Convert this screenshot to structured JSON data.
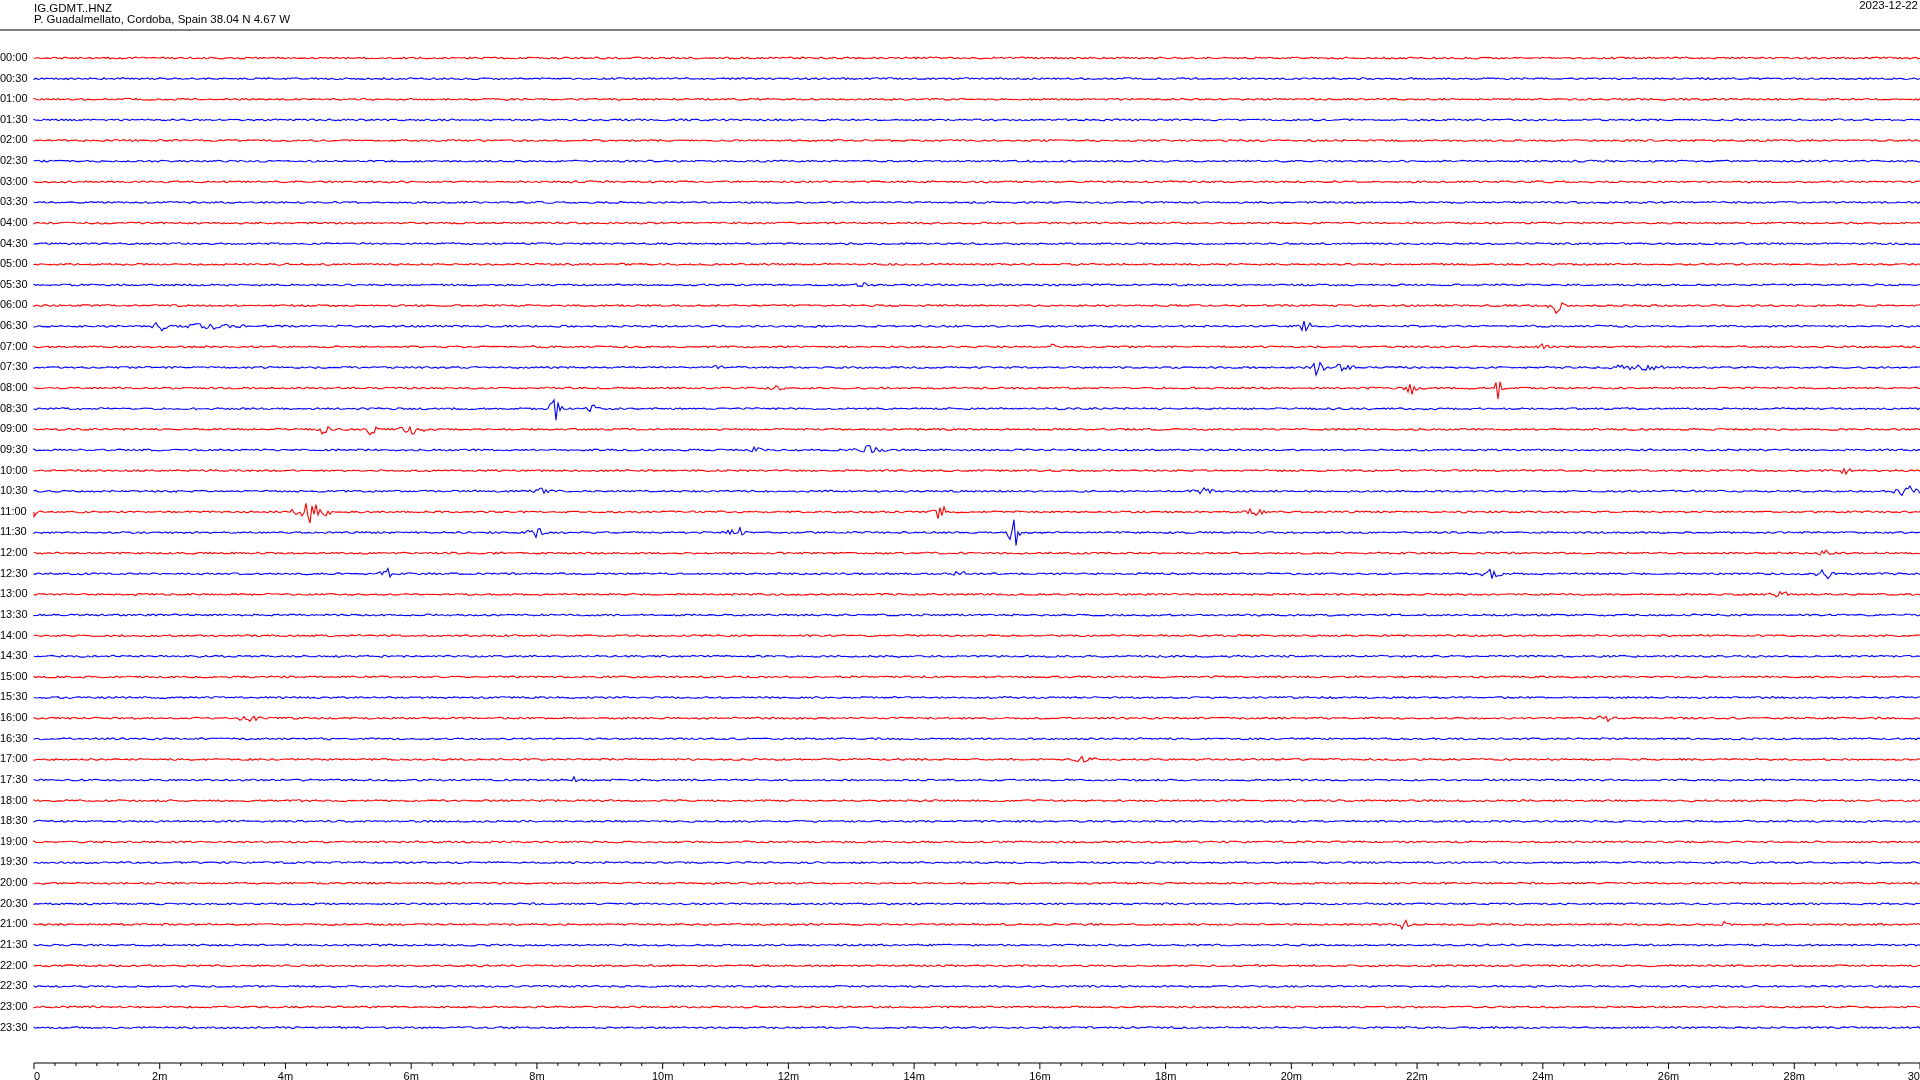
{
  "header": {
    "station": "IG.GDMT..HNZ",
    "location": "P. Guadalmellato, Cordoba, Spain  38.04 N 4.67 W",
    "date": "2023-12-22"
  },
  "rows": [
    {
      "time": "00:00",
      "color": "#ff0000"
    },
    {
      "time": "00:30",
      "color": "#0000ff"
    },
    {
      "time": "01:00",
      "color": "#ff0000"
    },
    {
      "time": "01:30",
      "color": "#0000ff"
    },
    {
      "time": "02:00",
      "color": "#ff0000"
    },
    {
      "time": "02:30",
      "color": "#0000ff"
    },
    {
      "time": "03:00",
      "color": "#ff0000"
    },
    {
      "time": "03:30",
      "color": "#0000ff"
    },
    {
      "time": "04:00",
      "color": "#ff0000"
    },
    {
      "time": "04:30",
      "color": "#0000ff"
    },
    {
      "time": "05:00",
      "color": "#ff0000"
    },
    {
      "time": "05:30",
      "color": "#0000ff"
    },
    {
      "time": "06:00",
      "color": "#ff0000"
    },
    {
      "time": "06:30",
      "color": "#0000ff"
    },
    {
      "time": "07:00",
      "color": "#ff0000"
    },
    {
      "time": "07:30",
      "color": "#0000ff"
    },
    {
      "time": "08:00",
      "color": "#ff0000"
    },
    {
      "time": "08:30",
      "color": "#0000ff"
    },
    {
      "time": "09:00",
      "color": "#ff0000"
    },
    {
      "time": "09:30",
      "color": "#0000ff"
    },
    {
      "time": "10:00",
      "color": "#ff0000"
    },
    {
      "time": "10:30",
      "color": "#0000ff"
    },
    {
      "time": "11:00",
      "color": "#ff0000"
    },
    {
      "time": "11:30",
      "color": "#0000ff"
    },
    {
      "time": "12:00",
      "color": "#ff0000"
    },
    {
      "time": "12:30",
      "color": "#0000ff"
    },
    {
      "time": "13:00",
      "color": "#ff0000"
    },
    {
      "time": "13:30",
      "color": "#0000ff"
    },
    {
      "time": "14:00",
      "color": "#ff0000"
    },
    {
      "time": "14:30",
      "color": "#0000ff"
    },
    {
      "time": "15:00",
      "color": "#ff0000"
    },
    {
      "time": "15:30",
      "color": "#0000ff"
    },
    {
      "time": "16:00",
      "color": "#ff0000"
    },
    {
      "time": "16:30",
      "color": "#0000ff"
    },
    {
      "time": "17:00",
      "color": "#ff0000"
    },
    {
      "time": "17:30",
      "color": "#0000ff"
    },
    {
      "time": "18:00",
      "color": "#ff0000"
    },
    {
      "time": "18:30",
      "color": "#0000ff"
    },
    {
      "time": "19:00",
      "color": "#ff0000"
    },
    {
      "time": "19:30",
      "color": "#0000ff"
    },
    {
      "time": "20:00",
      "color": "#ff0000"
    },
    {
      "time": "20:30",
      "color": "#0000ff"
    },
    {
      "time": "21:00",
      "color": "#ff0000"
    },
    {
      "time": "21:30",
      "color": "#0000ff"
    },
    {
      "time": "22:00",
      "color": "#ff0000"
    },
    {
      "time": "22:30",
      "color": "#0000ff"
    },
    {
      "time": "23:00",
      "color": "#ff0000"
    },
    {
      "time": "23:30",
      "color": "#0000ff"
    }
  ],
  "x_axis": {
    "labels": [
      "0",
      "2m",
      "4m",
      "6m",
      "8m",
      "10m",
      "12m",
      "14m",
      "16m",
      "18m",
      "20m",
      "22m",
      "24m",
      "26m",
      "28m",
      "30"
    ]
  }
}
